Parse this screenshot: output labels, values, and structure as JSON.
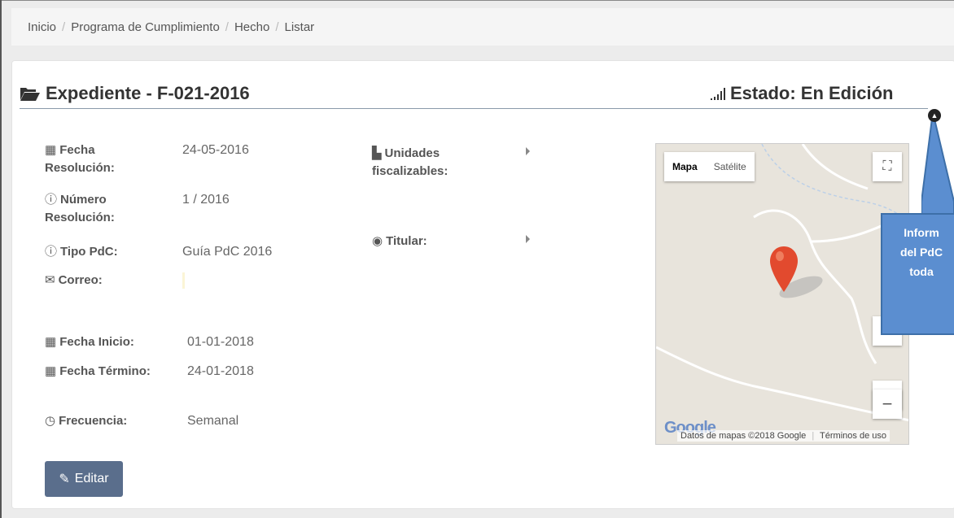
{
  "breadcrumb": [
    "Inicio",
    "Programa de Cumplimiento",
    "Hecho",
    "Listar"
  ],
  "header": {
    "title": "Expediente - F-021-2016",
    "status": "Estado: En Edición"
  },
  "fields_left": {
    "fecha_resolucion_label": "Fecha Resolución:",
    "fecha_resolucion_value": "24-05-2016",
    "numero_resolucion_label": "Número Resolución:",
    "numero_resolucion_value": "1 / 2016",
    "tipo_pdc_label": "Tipo PdC:",
    "tipo_pdc_value": "Guía PdC 2016",
    "correo_label": "Correo:",
    "correo_value": "",
    "fecha_inicio_label": "Fecha Inicio:",
    "fecha_inicio_value": "01-01-2018",
    "fecha_termino_label": "Fecha Término:",
    "fecha_termino_value": "24-01-2018",
    "frecuencia_label": "Frecuencia:",
    "frecuencia_value": "Semanal"
  },
  "fields_middle": {
    "unidades_label": "Unidades fiscalizables:",
    "titular_label": "Titular:"
  },
  "map": {
    "type_map": "Mapa",
    "type_satellite": "Satélite",
    "attribution": "Datos de mapas ©2018 Google",
    "terms": "Términos de uso",
    "logo": "Google"
  },
  "callout": [
    "Inform",
    "del PdC",
    "toda"
  ],
  "actions": {
    "edit_label": "Editar"
  },
  "icons": {
    "folder": "folder-open-icon",
    "signal": "signal-icon",
    "calendar": "calendar-icon",
    "info": "info-circle-icon",
    "envelope": "envelope-icon",
    "industry": "industry-icon",
    "user": "user-circle-icon",
    "clock": "clock-icon",
    "pencil": "pencil-icon"
  }
}
